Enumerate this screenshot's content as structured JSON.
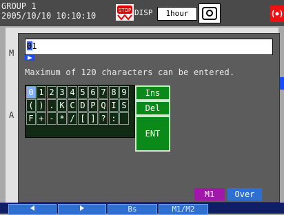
{
  "header": {
    "group": "GROUP 1",
    "datetime": "2005/10/10 10:10:10",
    "disp_label": "DISP",
    "time_div": "1hour",
    "stop_icon": "stop-icon",
    "record_icon": "record-icon",
    "alarm_icon": "alarm-icon"
  },
  "side_labels": {
    "m": "M",
    "a": "A"
  },
  "input": {
    "value": "01"
  },
  "message": "Maximum of 120 characters can be entered.",
  "keypad": {
    "rows": [
      [
        "0",
        "1",
        "2",
        "3",
        "4",
        "5",
        "6",
        "7",
        "8",
        "9"
      ],
      [
        "(",
        ")",
        ".",
        "K",
        "C",
        "D",
        "P",
        "Q",
        "I",
        "S"
      ],
      [
        "F",
        "+",
        "-",
        "*",
        "/",
        "[",
        "]",
        "?",
        ":",
        ""
      ]
    ],
    "selected": "0"
  },
  "buttons": {
    "ins": "Ins",
    "del": "Del",
    "ent": "ENT"
  },
  "status_tags": {
    "m1": "M1",
    "over": "Over"
  },
  "footer": {
    "left_icon": "left-arrow-icon",
    "right_icon": "right-arrow-icon",
    "bs": "Bs",
    "m1m2": "M1/M2"
  },
  "colors": {
    "accent_blue": "#2e6fd1",
    "keypad_bg": "#122a14",
    "function_green": "#0b8a1a",
    "m1_purple": "#a018a8"
  }
}
